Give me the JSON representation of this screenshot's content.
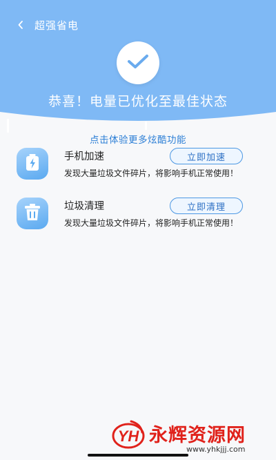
{
  "colors": {
    "header_bg": "#7fb9f5",
    "accent_text": "#2d7fd6",
    "button_border": "#4b97e3",
    "watermark_red": "#e0221b"
  },
  "header": {
    "title": "超强省电",
    "back_icon": "chevron-left-icon",
    "status_icon": "checkmark-icon",
    "success_message": "恭喜！电量已优化至最佳状态"
  },
  "promo_text": "点击体验更多炫酷功能",
  "features": [
    {
      "icon": "battery-bolt-icon",
      "title": "手机加速",
      "description": "发现大量垃圾文件碎片，将影响手机正常使用！",
      "button_label": "立即加速"
    },
    {
      "icon": "trash-icon",
      "title": "垃圾清理",
      "description": "发现大量垃圾文件碎片，将影响手机正常使用！",
      "button_label": "立即清理"
    }
  ],
  "watermark": {
    "logo_text": "YH",
    "name": "永辉资源网",
    "url": "www.yhkjjj.com"
  }
}
